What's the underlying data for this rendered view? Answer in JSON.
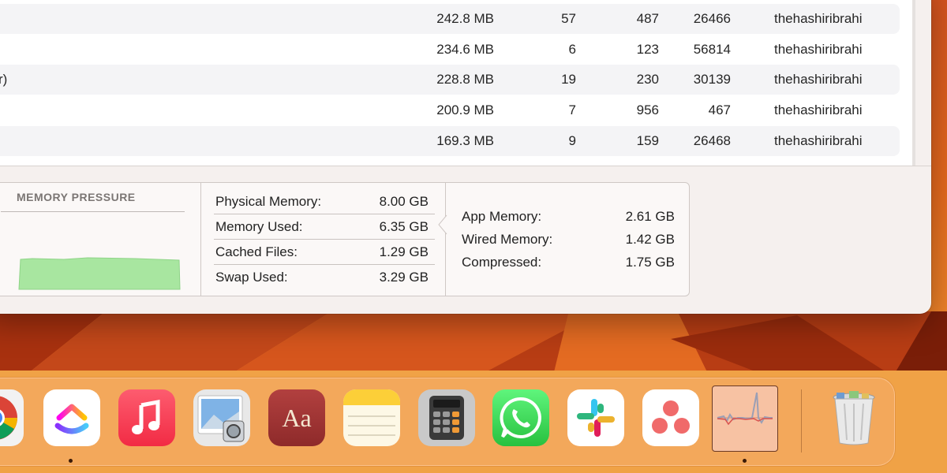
{
  "process_table": {
    "rows": [
      {
        "name": "",
        "memory": "242.8 MB",
        "threads": "57",
        "ports": "487",
        "pid": "26466",
        "user": "thehashiribrahi"
      },
      {
        "name": "",
        "memory": "234.6 MB",
        "threads": "6",
        "ports": "123",
        "pid": "56814",
        "user": "thehashiribrahi"
      },
      {
        "name": "r)",
        "memory": "228.8 MB",
        "threads": "19",
        "ports": "230",
        "pid": "30139",
        "user": "thehashiribrahi"
      },
      {
        "name": "",
        "memory": "200.9 MB",
        "threads": "7",
        "ports": "956",
        "pid": "467",
        "user": "thehashiribrahi"
      },
      {
        "name": "",
        "memory": "169.3 MB",
        "threads": "9",
        "ports": "159",
        "pid": "26468",
        "user": "thehashiribrahi"
      }
    ]
  },
  "memory_pressure": {
    "title": "MEMORY PRESSURE",
    "color": "#a8e6a0"
  },
  "memory_summary": {
    "physical_memory": {
      "label": "Physical Memory:",
      "value": "8.00 GB"
    },
    "memory_used": {
      "label": "Memory Used:",
      "value": "6.35 GB"
    },
    "cached_files": {
      "label": "Cached Files:",
      "value": "1.29 GB"
    },
    "swap_used": {
      "label": "Swap Used:",
      "value": "3.29 GB"
    }
  },
  "memory_detail": {
    "app_memory": {
      "label": "App Memory:",
      "value": "2.61 GB"
    },
    "wired_memory": {
      "label": "Wired Memory:",
      "value": "1.42 GB"
    },
    "compressed": {
      "label": "Compressed:",
      "value": "1.75 GB"
    }
  },
  "dock": {
    "apps": [
      {
        "icon": "chrome-icon",
        "running": false
      },
      {
        "icon": "clickup-icon",
        "running": true
      },
      {
        "icon": "music-icon",
        "running": false
      },
      {
        "icon": "preview-icon",
        "running": false
      },
      {
        "icon": "dictionary-icon",
        "running": false
      },
      {
        "icon": "notes-icon",
        "running": false
      },
      {
        "icon": "calculator-icon",
        "running": false
      },
      {
        "icon": "whatsapp-icon",
        "running": false
      },
      {
        "icon": "slack-icon",
        "running": false
      },
      {
        "icon": "asana-icon",
        "running": false
      },
      {
        "icon": "activity-monitor-icon",
        "running": true
      },
      {
        "icon": "trash-icon",
        "running": false
      }
    ],
    "dictionary_glyph": "Aa"
  }
}
